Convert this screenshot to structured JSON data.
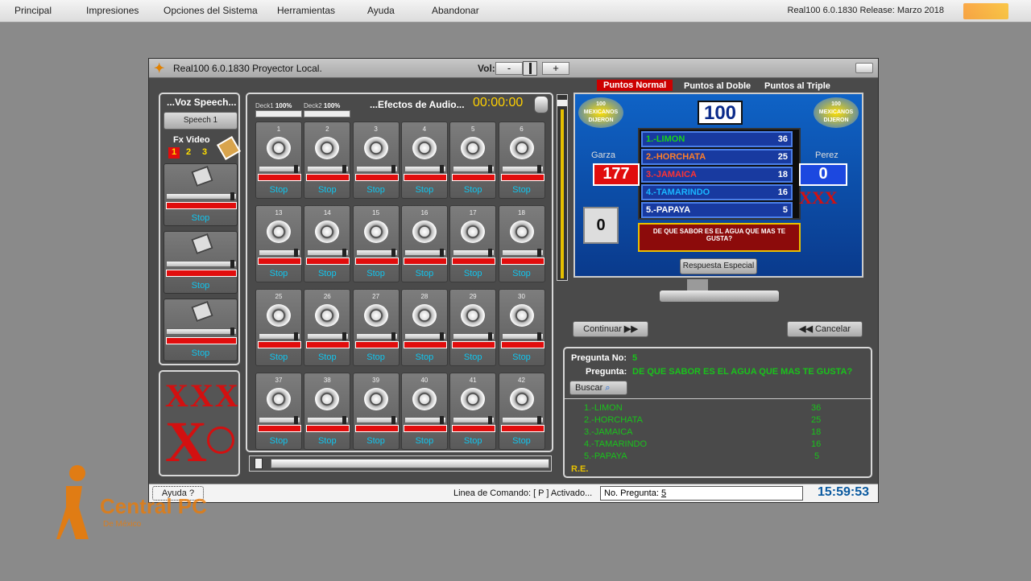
{
  "menu": {
    "items": [
      "Principal",
      "Impresiones",
      "Opciones del Sistema",
      "Herramientas",
      "Ayuda",
      "Abandonar"
    ],
    "release": "Real100 6.0.1830 Release: Marzo 2018"
  },
  "window": {
    "title": "Real100 6.0.1830 Proyector Local.",
    "vol_label": "Vol:",
    "vol_minus": "-",
    "vol_plus": "+"
  },
  "voz": {
    "title": "...Voz Speech...",
    "speech_button": "Speech 1",
    "fx_title": "Fx Video",
    "fx_nums": [
      "1",
      "2",
      "3"
    ],
    "stop": "Stop"
  },
  "efectos": {
    "title": "...Efectos de Audio...",
    "timer": "00:00:00",
    "deck1": "Deck1",
    "deck1_pct": "100%",
    "deck2": "Deck2",
    "deck2_pct": "100%",
    "stop": "Stop",
    "rows": [
      [
        "1",
        "2",
        "3",
        "4",
        "5",
        "6"
      ],
      [
        "13",
        "14",
        "15",
        "16",
        "17",
        "18"
      ],
      [
        "25",
        "26",
        "27",
        "28",
        "29",
        "30"
      ],
      [
        "37",
        "38",
        "39",
        "40",
        "41",
        "42"
      ]
    ]
  },
  "tabs": {
    "normal": "Puntos Normal",
    "doble": "Puntos al Doble",
    "triple": "Puntos al Triple",
    "accent": "#cc0000"
  },
  "board": {
    "total": "100",
    "left_team": "Garza",
    "left_score": "177",
    "right_team": "Perez",
    "right_score": "0",
    "strikes": "XXX",
    "timer": "0",
    "answers": [
      {
        "t": "1.-LIMON",
        "p": "36"
      },
      {
        "t": "2.-HORCHATA",
        "p": "25"
      },
      {
        "t": "3.-JAMAICA",
        "p": "18"
      },
      {
        "t": "4.-TAMARINDO",
        "p": "16"
      },
      {
        "t": "5.-PAPAYA",
        "p": "5"
      }
    ],
    "question": "DE QUE SABOR ES EL AGUA QUE MAS TE GUSTA?",
    "logo_line1": "100",
    "logo_line2": "MEXICANOS",
    "logo_line3": "DIJERON"
  },
  "especial": "Respuesta Especial",
  "continuar": "Continuar",
  "cancelar": "Cancelar",
  "pregunta": {
    "no_label": "Pregunta No:",
    "no": "5",
    "q_label": "Pregunta:",
    "q": "DE QUE SABOR ES EL AGUA QUE MAS TE GUSTA?",
    "buscar": "Buscar",
    "list": [
      "1.-LIMON",
      "2.-HORCHATA",
      "3.-JAMAICA",
      "4.-TAMARINDO",
      "5.-PAPAYA",
      "R.E."
    ],
    "pts": [
      "36",
      "25",
      "18",
      "16",
      "5"
    ]
  },
  "status": {
    "ayuda": "Ayuda",
    "cmd": "Linea de Comando: [ P ] Activado...",
    "npreg_label": "No. Pregunta:",
    "npreg": "5",
    "clock": "15:59:53"
  },
  "watermark": {
    "brand": "Central PC",
    "sub": "De México"
  },
  "xxx": {
    "big": "XXX",
    "single": "X"
  }
}
